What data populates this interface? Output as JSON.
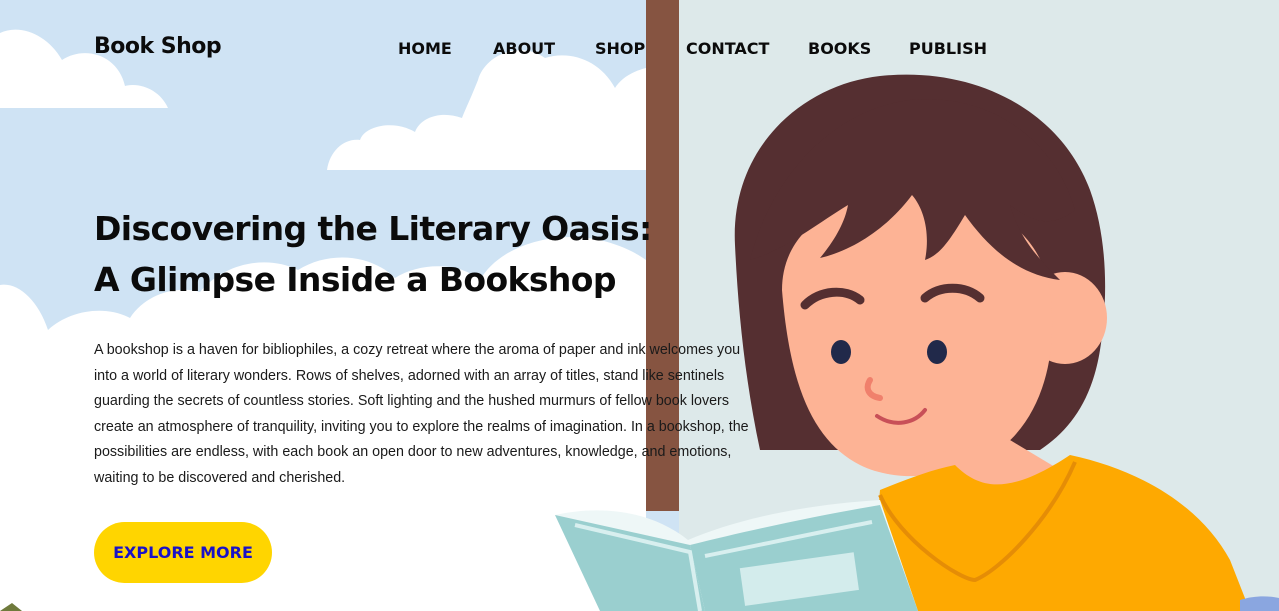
{
  "brand": {
    "name": "Book Shop"
  },
  "nav": {
    "items": [
      {
        "label": "HOME"
      },
      {
        "label": "ABOUT"
      },
      {
        "label": "SHOP"
      },
      {
        "label": "CONTACT"
      },
      {
        "label": "BOOKS"
      },
      {
        "label": "PUBLISH"
      }
    ]
  },
  "hero": {
    "headline": "Discovering the Literary Oasis: A Glimpse Inside a Bookshop",
    "paragraph": "A bookshop is a haven for bibliophiles, a cozy retreat where the aroma of paper and ink welcomes you into a world of literary wonders. Rows of shelves, adorned with an array of titles, stand like sentinels guarding the secrets of countless stories. Soft lighting and the hushed murmurs of fellow book lovers create an atmosphere of tranquility, inviting you to explore the realms of imagination. In a bookshop, the possibilities are endless, with each book an open door to new adventures, knowledge, and emotions, waiting to be discovered and cherished.",
    "cta_label": "EXPLORE MORE"
  },
  "colors": {
    "sky": "#cfe3f4",
    "wall": "#dde9ea",
    "window_frame": "#865441",
    "cta_background": "#ffd500",
    "cta_text": "#1a12c7",
    "hair": "#552f31",
    "skin": "#fdb395",
    "shirt": "#fea901",
    "book": "#9acfcf"
  },
  "illustration": {
    "name": "child-reading-book-illustration"
  }
}
